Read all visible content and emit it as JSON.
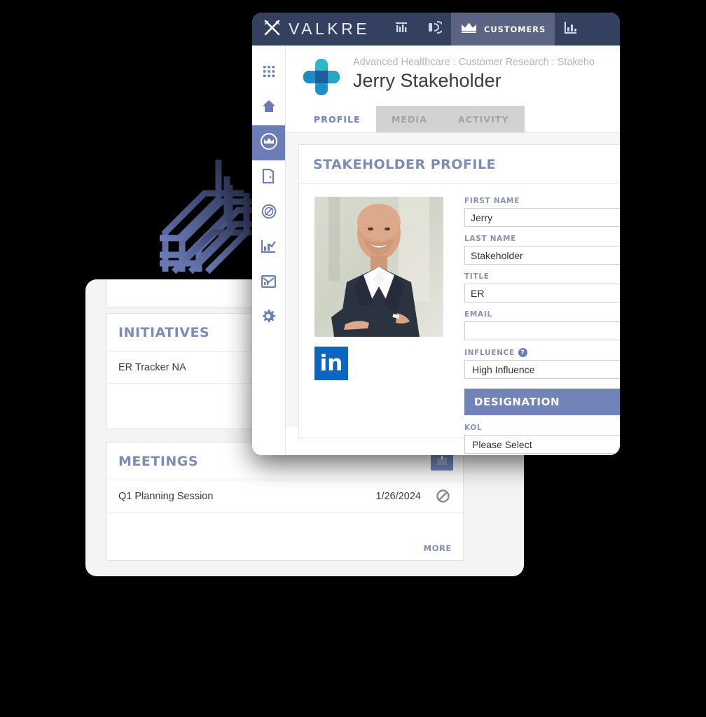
{
  "topbar": {
    "brand": "VALKRE",
    "brand_icon": "crossed-swords-icon",
    "nav": [
      {
        "id": "dashboard",
        "icon": "bar-columns-icon",
        "label": "",
        "active": false
      },
      {
        "id": "broadcast",
        "icon": "signal-broadcast-icon",
        "label": "",
        "active": false
      },
      {
        "id": "customers",
        "icon": "crown-icon",
        "label": "CUSTOMERS",
        "active": true
      },
      {
        "id": "analytics",
        "icon": "bar-chart-icon",
        "label": "",
        "active": false
      }
    ]
  },
  "sidebar": {
    "items": [
      {
        "id": "apps",
        "icon": "grid-apps-icon",
        "active": false
      },
      {
        "id": "home",
        "icon": "home-icon",
        "active": false
      },
      {
        "id": "customers",
        "icon": "crown-circle-icon",
        "active": true
      },
      {
        "id": "door",
        "icon": "door-icon",
        "active": false
      },
      {
        "id": "value",
        "icon": "dollar-circle-icon",
        "active": false
      },
      {
        "id": "reports",
        "icon": "chart-check-icon",
        "active": false
      },
      {
        "id": "messages",
        "icon": "mail-chart-icon",
        "active": false
      },
      {
        "id": "settings",
        "icon": "gear-icon",
        "active": false
      }
    ]
  },
  "page": {
    "logo_icon": "medical-cross-icon",
    "breadcrumb": "Advanced Healthcare : Customer Research : Stakeho",
    "title": "Jerry Stakeholder"
  },
  "tabs": [
    {
      "label": "PROFILE",
      "active": true
    },
    {
      "label": "MEDIA",
      "active": false
    },
    {
      "label": "ACTIVITY",
      "active": false
    }
  ],
  "profile_panel": {
    "title": "STAKEHOLDER PROFILE",
    "photo_alt": "stakeholder-photo",
    "linkedin_label": "in",
    "fields": [
      {
        "label": "FIRST NAME",
        "value": "Jerry",
        "type": "text",
        "help": false
      },
      {
        "label": "LAST NAME",
        "value": "Stakeholder",
        "type": "text",
        "help": false
      },
      {
        "label": "TITLE",
        "value": "ER",
        "type": "text",
        "help": false
      },
      {
        "label": "EMAIL",
        "value": "",
        "type": "text",
        "help": false
      },
      {
        "label": "INFLUENCE",
        "value": "High Influence",
        "type": "select",
        "help": true
      }
    ],
    "section_bar": "DESIGNATION",
    "designation_fields": [
      {
        "label": "KOL",
        "value": "Please Select",
        "type": "select",
        "help": false
      }
    ]
  },
  "back_window": {
    "cards": [
      {
        "id": "initiatives",
        "title": "INITIATIVES",
        "rows": [
          {
            "name": "ER Tracker NA",
            "date": "",
            "icon": ""
          }
        ],
        "more": "",
        "add_button": false
      },
      {
        "id": "meetings",
        "title": "MEETINGS",
        "rows": [
          {
            "name": "Q1 Planning Session",
            "date": "1/26/2024",
            "icon": "no-entry-icon"
          }
        ],
        "more": "MORE",
        "add_button": true,
        "add_icon": "add-calendar-icon"
      }
    ]
  },
  "colors": {
    "topbar_bg": "#33405f",
    "topbar_active": "#5b6583",
    "accent": "#7183b8",
    "label_blue": "#8791b0",
    "title_blue": "#7e8cb5",
    "tab_active": "#6d7fb9",
    "linkedin": "#0a66c2",
    "page_bg": "#000000",
    "knot": "#5a6ba5"
  }
}
